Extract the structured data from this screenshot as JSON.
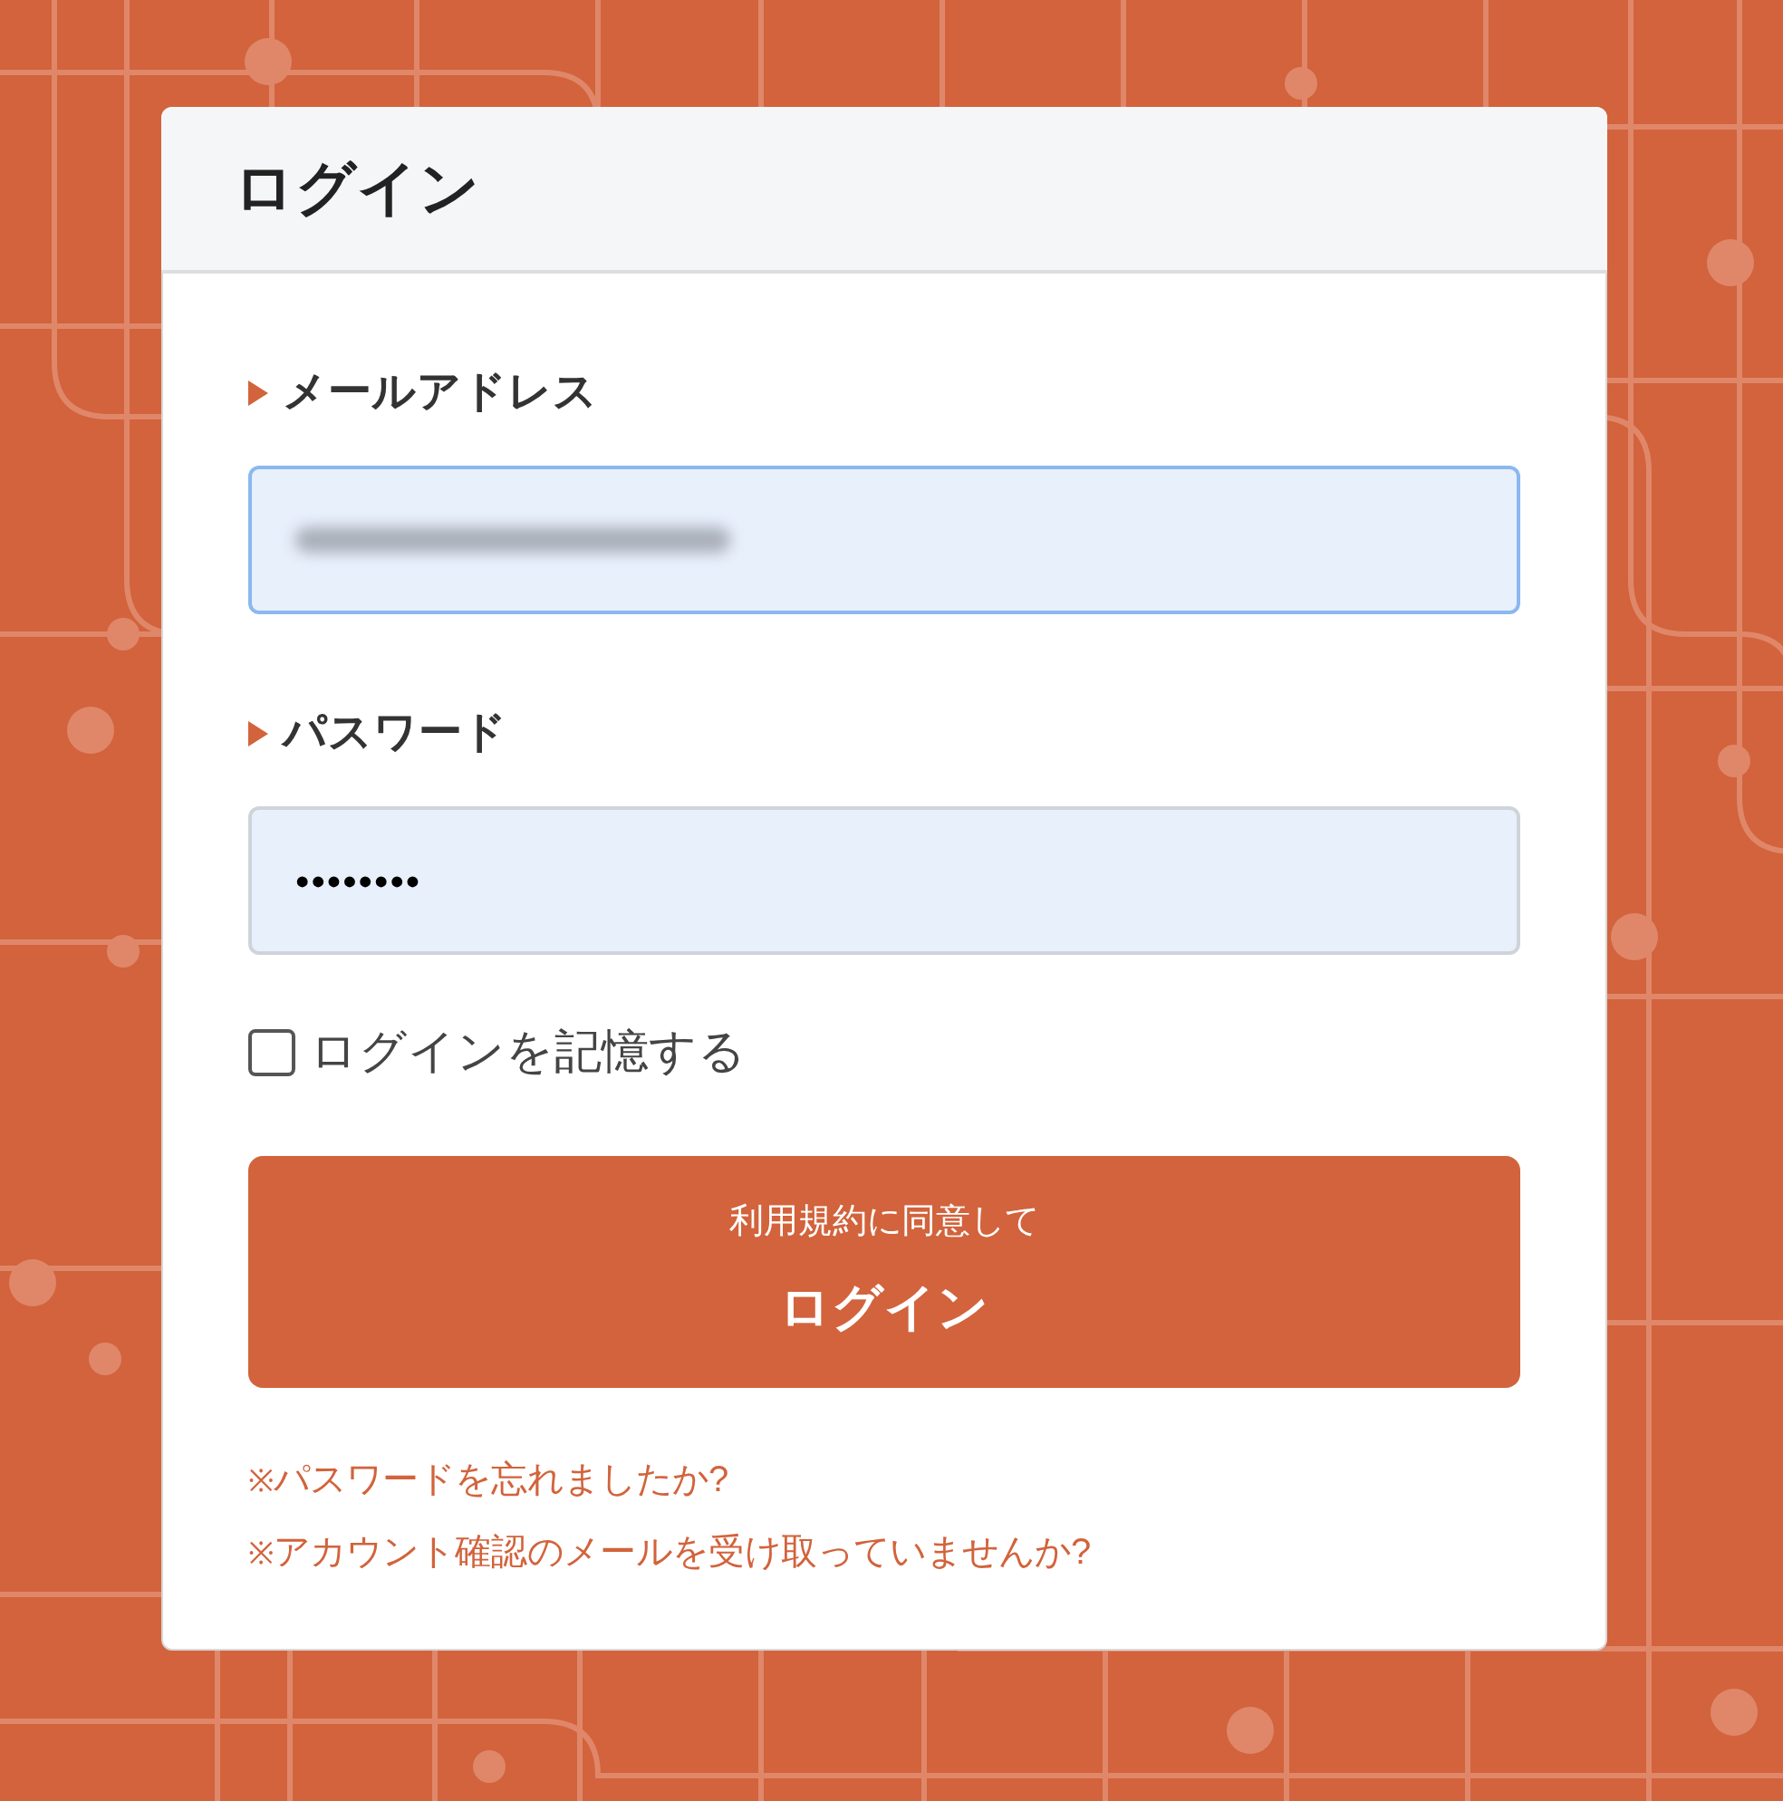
{
  "card": {
    "title": "ログイン"
  },
  "fields": [
    {
      "label": "メールアドレス",
      "kind": "redacted",
      "focused": true
    },
    {
      "label": "パスワード",
      "kind": "password",
      "value": "••••••••",
      "focused": false
    }
  ],
  "remember": {
    "label": "ログインを記憶する",
    "checked": false
  },
  "submit": {
    "caption": "利用規約に同意して",
    "label": "ログイン"
  },
  "links": [
    {
      "mark": "※",
      "text": "パスワードを忘れましたか?"
    },
    {
      "mark": "※",
      "text": "アカウント確認のメールを受け取っていませんか?"
    }
  ]
}
